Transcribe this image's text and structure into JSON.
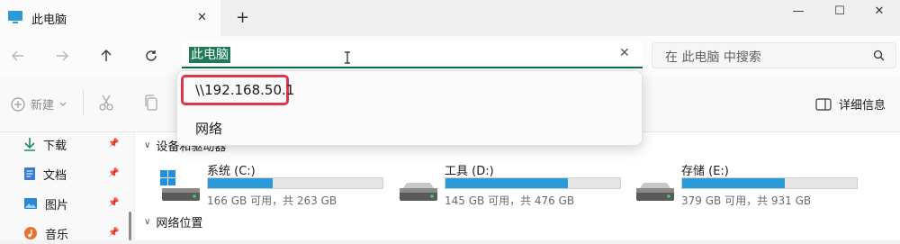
{
  "tab": {
    "title": "此电脑",
    "close": "✕",
    "new": "+"
  },
  "window": {
    "minimize": "—",
    "maximize": "☐",
    "close": "✕"
  },
  "address": {
    "value": "此电脑",
    "clear": "✕"
  },
  "search": {
    "placeholder": "在 此电脑 中搜索"
  },
  "toolbar": {
    "new_label": "新建",
    "details_label": "详细信息"
  },
  "dropdown": {
    "items": [
      {
        "label": "\\\\192.168.50.1"
      },
      {
        "label": "网络"
      }
    ]
  },
  "sidebar": {
    "items": [
      {
        "label": "下载",
        "icon": "download-icon"
      },
      {
        "label": "文档",
        "icon": "document-icon"
      },
      {
        "label": "图片",
        "icon": "picture-icon"
      },
      {
        "label": "音乐",
        "icon": "music-icon"
      }
    ]
  },
  "main": {
    "devices_header": "设备和驱动器",
    "network_header": "网络位置",
    "drives": [
      {
        "name": "系统 (C:)",
        "info": "166 GB 可用，共 263 GB",
        "used_fraction": 0.37
      },
      {
        "name": "工具 (D:)",
        "info": "145 GB 可用，共 476 GB",
        "used_fraction": 0.7
      },
      {
        "name": "存储 (E:)",
        "info": "379 GB 可用，共 931 GB",
        "used_fraction": 0.59
      }
    ]
  },
  "colors": {
    "accent": "#0a6e4f",
    "drive_fill": "#2a9bd8",
    "highlight": "#e0344a"
  }
}
